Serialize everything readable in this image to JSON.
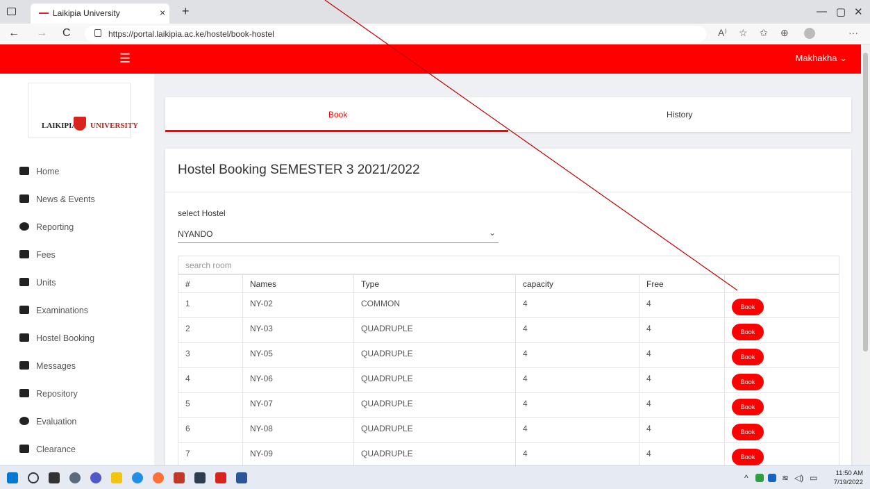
{
  "browser": {
    "tab_title": "Laikipia University",
    "tab_close": "×",
    "new_tab": "+",
    "url": "https://portal.laikipia.ac.ke/hostel/book-hostel",
    "nav_back": "←",
    "nav_forward": "→",
    "nav_reload": "C",
    "more": "···",
    "win_min": "—",
    "win_max": "▢",
    "win_close": "✕"
  },
  "header": {
    "menu_icon": "☰",
    "user_name": "Makhakha ⌄"
  },
  "sidebar": {
    "logo_left": "LAIKIPIA",
    "logo_right": "UNIVERSITY",
    "items": [
      {
        "label": "Home",
        "icon": "home-icon"
      },
      {
        "label": "News & Events",
        "icon": "calendar-icon"
      },
      {
        "label": "Reporting",
        "icon": "clock-icon"
      },
      {
        "label": "Fees",
        "icon": "money-icon"
      },
      {
        "label": "Units",
        "icon": "book-icon"
      },
      {
        "label": "Examinations",
        "icon": "graduation-cap-icon"
      },
      {
        "label": "Hostel Booking",
        "icon": "bed-icon"
      },
      {
        "label": "Messages",
        "icon": "comments-icon"
      },
      {
        "label": "Repository",
        "icon": "folder-icon"
      },
      {
        "label": "Evaluation",
        "icon": "clock-icon"
      },
      {
        "label": "Clearance",
        "icon": "file-icon"
      }
    ]
  },
  "tabs": {
    "book": "Book",
    "history": "History"
  },
  "booking": {
    "heading": "Hostel Booking SEMESTER 3 2021/2022",
    "select_label": "select Hostel",
    "selected_hostel": "NYANDO",
    "search_placeholder": "search room",
    "columns": [
      "#",
      "Names",
      "Type",
      "capacity",
      "Free",
      ""
    ],
    "book_label": "Book",
    "rows": [
      [
        "1",
        "NY-02",
        "COMMON",
        "4",
        "4"
      ],
      [
        "2",
        "NY-03",
        "QUADRUPLE",
        "4",
        "4"
      ],
      [
        "3",
        "NY-05",
        "QUADRUPLE",
        "4",
        "4"
      ],
      [
        "4",
        "NY-06",
        "QUADRUPLE",
        "4",
        "4"
      ],
      [
        "5",
        "NY-07",
        "QUADRUPLE",
        "4",
        "4"
      ],
      [
        "6",
        "NY-08",
        "QUADRUPLE",
        "4",
        "4"
      ],
      [
        "7",
        "NY-09",
        "QUADRUPLE",
        "4",
        "4"
      ]
    ]
  },
  "taskbar": {
    "time": "11:50 AM",
    "date": "7/19/2022"
  },
  "colors": {
    "brand_red": "#fe0000",
    "accent_blue": "#6aa0d8"
  }
}
